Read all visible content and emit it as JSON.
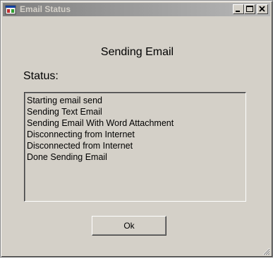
{
  "window": {
    "title": "Email Status",
    "colors": {
      "face": "#d4d0c8",
      "titlebar_inactive_start": "#808080",
      "titlebar_inactive_end": "#b8b8b8"
    }
  },
  "titlebar_buttons": {
    "minimize_icon": "minimize-icon",
    "maximize_icon": "maximize-icon",
    "close_icon": "close-icon"
  },
  "main": {
    "heading": "Sending Email",
    "status_label": "Status:",
    "log_lines": [
      "Starting email send",
      "Sending Text Email",
      "Sending Email With Word Attachment",
      "Disconnecting from Internet",
      "Disconnected from Internet",
      "Done Sending Email"
    ]
  },
  "footer": {
    "ok_label": "Ok"
  }
}
